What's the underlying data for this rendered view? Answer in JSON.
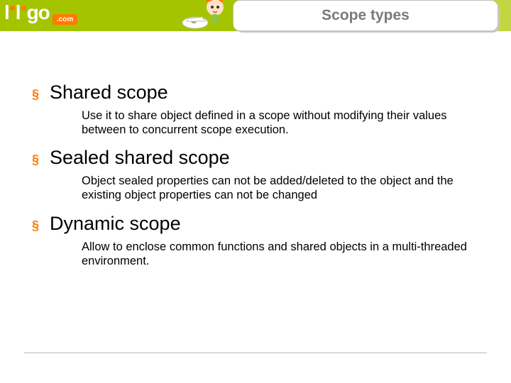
{
  "logo": {
    "com": ".com"
  },
  "title": "Scope types",
  "items": [
    {
      "heading": "Shared scope",
      "desc": "Use it to share object defined in a scope without modifying their values between to concurrent scope execution."
    },
    {
      "heading": "Sealed shared scope",
      "desc": "Object sealed properties can not be added/deleted to the object and the existing object properties can not be changed"
    },
    {
      "heading": "Dynamic scope",
      "desc": "Allow to enclose common functions and shared objects in a multi-threaded environment."
    }
  ]
}
